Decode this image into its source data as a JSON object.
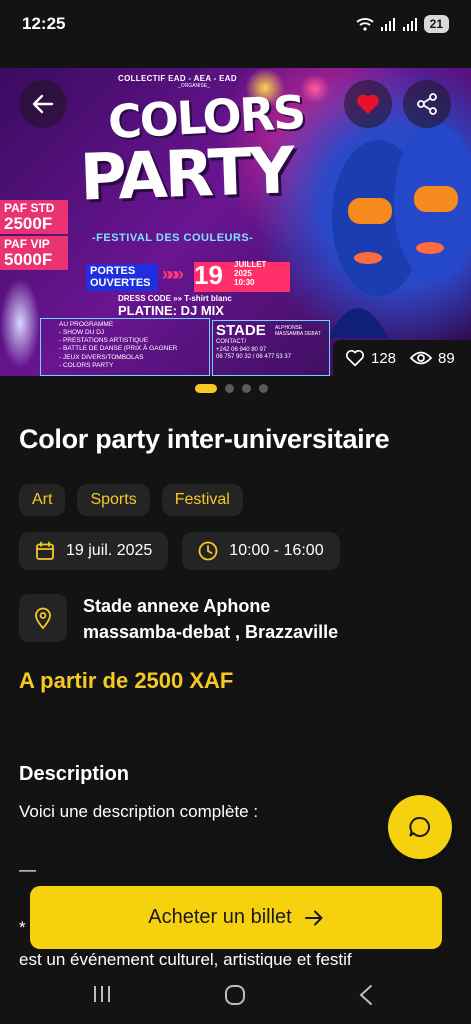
{
  "status_bar": {
    "time": "12:25",
    "battery": "21",
    "icons": [
      "wifi-icon",
      "signal-icon",
      "signal-icon"
    ]
  },
  "hero": {
    "poster": {
      "organizers": "COLLECTIF EAD - AEA - EAD",
      "organise": "_ORGANISE_",
      "title_line1": "COLORS",
      "title_line2": "PARTY",
      "festival": "-FESTIVAL DES COULEURS-",
      "paf_std_label": "PAF STD",
      "paf_std_price": "2500F",
      "paf_vip_label": "PAF VIP",
      "paf_vip_price": "5000F",
      "portes": "PORTES OUVERTES",
      "arrows": "»»»",
      "day": "19",
      "month_info": "JUILLET 2025 10:30",
      "dress_code": "DRESS CODE »» T-shirt blanc",
      "platine": "PLATINE: DJ MIX",
      "programme": [
        "AU PROGRAMME",
        "- SHOW DU DJ",
        "- PRESTATIONS ARTISTIQUE",
        "- BATTLE DE DANSE (PRIX À GAGNER",
        "- JEUX DIVERS/TOMBOLAS",
        "- COLORS PARTY"
      ],
      "stade": "STADE",
      "stade_sub": "ALPHONSE MASSAMBA DEBAT",
      "contact": [
        "CONTACT/",
        "+242 06 940 80 97",
        "06 757 90 32 / 06 477 53 37"
      ]
    },
    "likes": "128",
    "views": "89",
    "carousel": {
      "total": 4,
      "active": 0
    }
  },
  "event": {
    "title": "Color party inter-universitaire",
    "tags": [
      "Art",
      "Sports",
      "Festival"
    ],
    "date": "19 juil. 2025",
    "time": "10:00 - 16:00",
    "location_line1": "Stade annexe Aphone",
    "location_line2": "massamba-debat , Brazzaville",
    "price": "A partir de 2500 XAF"
  },
  "description": {
    "heading": "Description",
    "line1": "Voici une description complète :",
    "line2": "—",
    "line3": "*",
    "line4": "est un événement culturel, artistique et festif"
  },
  "actions": {
    "buy_label": "Acheter un billet"
  },
  "colors": {
    "accent": "#f6d20e",
    "background": "#131313",
    "chip_bg": "#242424",
    "favorite": "#e8112d"
  }
}
